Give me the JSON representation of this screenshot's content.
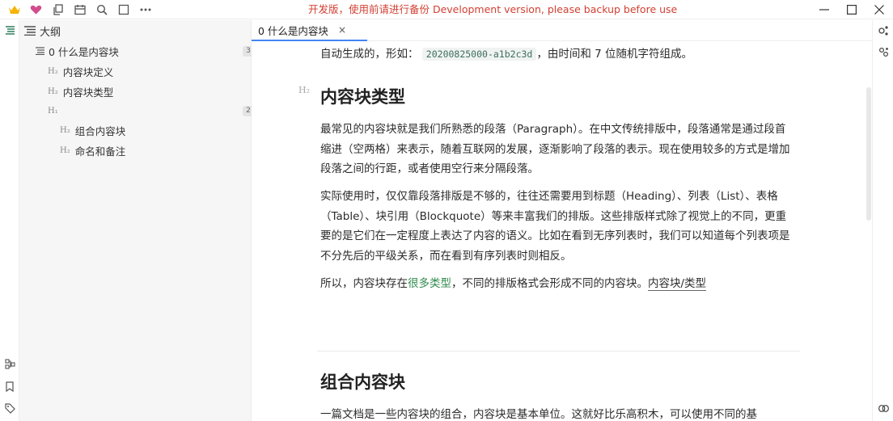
{
  "titlebar": {
    "title": "开发版，使用前请进行备份 Development version, please backup before use",
    "left_icons": [
      "crown-icon",
      "heart-icon",
      "copy-icon",
      "calendar-icon",
      "search-icon",
      "square-icon",
      "more-icon"
    ],
    "window_buttons": [
      "minimize-icon",
      "maximize-icon",
      "close-icon"
    ]
  },
  "outline": {
    "header": "大纲",
    "items": [
      {
        "label": "0 什么是内容块",
        "mark": "",
        "count": "3"
      },
      {
        "label": "内容块定义",
        "mark": "H₂",
        "count": ""
      },
      {
        "label": "内容块类型",
        "mark": "H₂",
        "count": ""
      },
      {
        "label": "",
        "mark": "H₁",
        "count": "2"
      },
      {
        "label": "组合内容块",
        "mark": "H₂",
        "count": ""
      },
      {
        "label": "命名和备注",
        "mark": "H₂",
        "count": ""
      }
    ]
  },
  "tab": {
    "label": "0 什么是内容块",
    "close": "×"
  },
  "editor": {
    "intro_prefix": "自动生成的，形如：",
    "intro_code": "20200825000-a1b2c3d",
    "intro_suffix": "，由时间和 7 位随机字符组成。",
    "h2_mark": "H₂",
    "heading_types": "内容块类型",
    "para1": "最常见的内容块就是我们所熟悉的段落（Paragraph）。在中文传统排版中，段落通常是通过段首缩进（空两格）来表示，随着互联网的发展，逐渐影响了段落的表示。现在使用较多的方式是增加段落之间的行距，或者使用空行来分隔段落。",
    "para2": "实际使用时，仅仅靠段落排版是不够的，往往还需要用到标题（Heading）、列表（List）、表格（Table）、块引用（Blockquote）等来丰富我们的排版。这些排版样式除了视觉上的不同，更重要的是它们在一定程度上表达了内容的语义。比如在看到无序列表时，我们可以知道每个列表项是不分先后的平级关系，而在看到有序列表时则相反。",
    "para3_prefix": "所以，内容块存在",
    "para3_link": "很多类型",
    "para3_middle": "，不同的排版格式会形成不同的内容块。",
    "para3_ref": "内容块/类型",
    "heading_combo": "组合内容块",
    "para4": "一篇文档是一些内容块的组合，内容块是基本单位。这就好比乐高积木，可以使用不同的基"
  },
  "colors": {
    "accent": "#4285f4",
    "dev_warning": "#d23f31",
    "link": "#2f8a4c",
    "outline_bg": "#f6f6f6"
  }
}
